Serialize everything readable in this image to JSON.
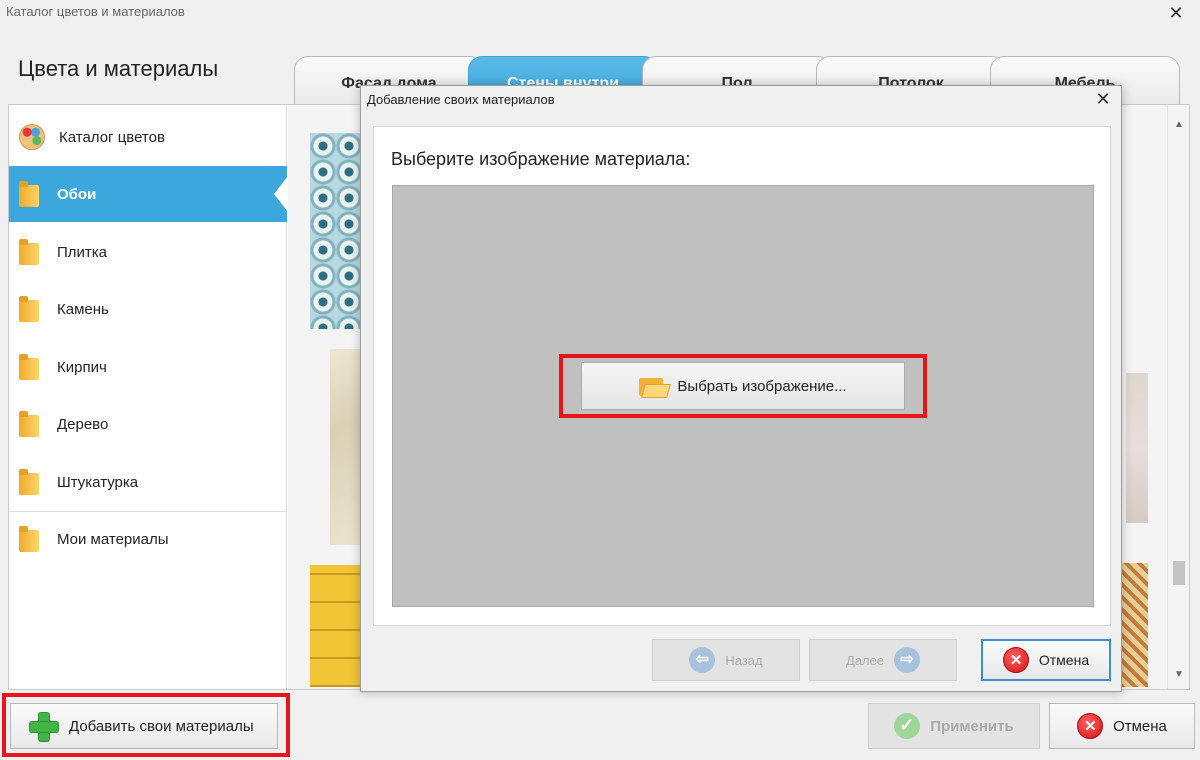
{
  "window": {
    "title": "Каталог цветов и материалов",
    "close": "✕"
  },
  "page_title": "Цвета и материалы",
  "tabs": [
    {
      "label": "Фасад дома",
      "active": false
    },
    {
      "label": "Стены внутри",
      "active": true
    },
    {
      "label": "Пол",
      "active": false
    },
    {
      "label": "Потолок",
      "active": false
    },
    {
      "label": "Мебель",
      "active": false
    }
  ],
  "sidebar": {
    "items": [
      {
        "label": "Каталог цветов",
        "icon": "palette-icon"
      },
      {
        "label": "Обои",
        "icon": "folder-icon",
        "active": true
      },
      {
        "label": "Плитка",
        "icon": "folder-icon"
      },
      {
        "label": "Камень",
        "icon": "folder-icon"
      },
      {
        "label": "Кирпич",
        "icon": "folder-icon"
      },
      {
        "label": "Дерево",
        "icon": "folder-icon"
      },
      {
        "label": "Штукатурка",
        "icon": "folder-icon"
      },
      {
        "label": "Мои материалы",
        "icon": "folder-icon"
      }
    ]
  },
  "footer": {
    "add_label": "Добавить свои материалы",
    "apply_label": "Применить",
    "cancel_label": "Отмена"
  },
  "dialog": {
    "title": "Добавление своих материалов",
    "close": "✕",
    "prompt": "Выберите изображение материала:",
    "choose_label": "Выбрать изображение...",
    "back_label": "Назад",
    "next_label": "Далее",
    "cancel_label": "Отмена"
  },
  "colors": {
    "accent": "#3ca7dc",
    "highlight": "#e8141b"
  }
}
